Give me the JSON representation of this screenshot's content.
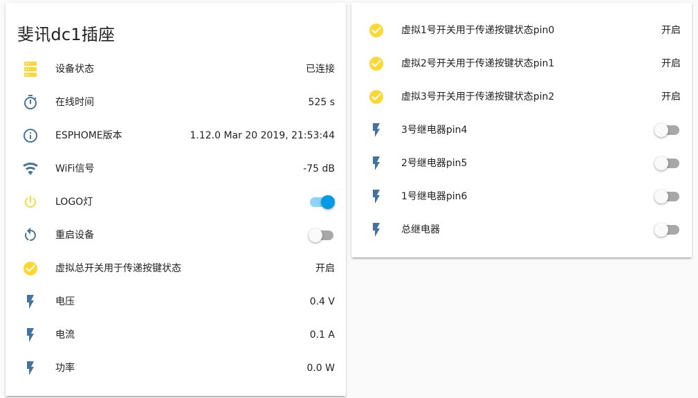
{
  "colors": {
    "icon_blue": "#44739e",
    "icon_yellow": "#fdd835",
    "toggle_on": "#039be5",
    "toggle_on_track": "#7fd0f7"
  },
  "left_card": {
    "title": "斐讯dc1插座",
    "rows": [
      {
        "icon": "server-icon",
        "label": "设备状态",
        "value": "已连接"
      },
      {
        "icon": "timer-icon",
        "label": "在线时间",
        "value": "525 s"
      },
      {
        "icon": "info-icon",
        "label": "ESPHOME版本",
        "value": "1.12.0 Mar 20 2019, 21:53:44"
      },
      {
        "icon": "wifi-icon",
        "label": "WiFi信号",
        "value": "-75 dB"
      },
      {
        "icon": "power-icon",
        "label": "LOGO灯",
        "toggle": "on"
      },
      {
        "icon": "restart-icon",
        "label": "重启设备",
        "toggle": "off"
      },
      {
        "icon": "check-circle-icon",
        "label": "虚拟总开关用于传递按键状态",
        "value": "开启"
      },
      {
        "icon": "flash-icon",
        "label": "电压",
        "value": "0.4 V"
      },
      {
        "icon": "flash-icon",
        "label": "电流",
        "value": "0.1 A"
      },
      {
        "icon": "flash-icon",
        "label": "功率",
        "value": "0.0 W"
      }
    ]
  },
  "right_card": {
    "rows": [
      {
        "icon": "check-circle-icon",
        "label": "虚拟1号开关用于传递按键状态pin0",
        "value": "开启"
      },
      {
        "icon": "check-circle-icon",
        "label": "虚拟2号开关用于传递按键状态pin1",
        "value": "开启"
      },
      {
        "icon": "check-circle-icon",
        "label": "虚拟3号开关用于传递按键状态pin2",
        "value": "开启"
      },
      {
        "icon": "flash-icon",
        "label": "3号继电器pin4",
        "toggle": "off"
      },
      {
        "icon": "flash-icon",
        "label": "2号继电器pin5",
        "toggle": "off"
      },
      {
        "icon": "flash-icon",
        "label": "1号继电器pin6",
        "toggle": "off"
      },
      {
        "icon": "flash-icon",
        "label": "总继电器",
        "toggle": "off"
      }
    ]
  }
}
